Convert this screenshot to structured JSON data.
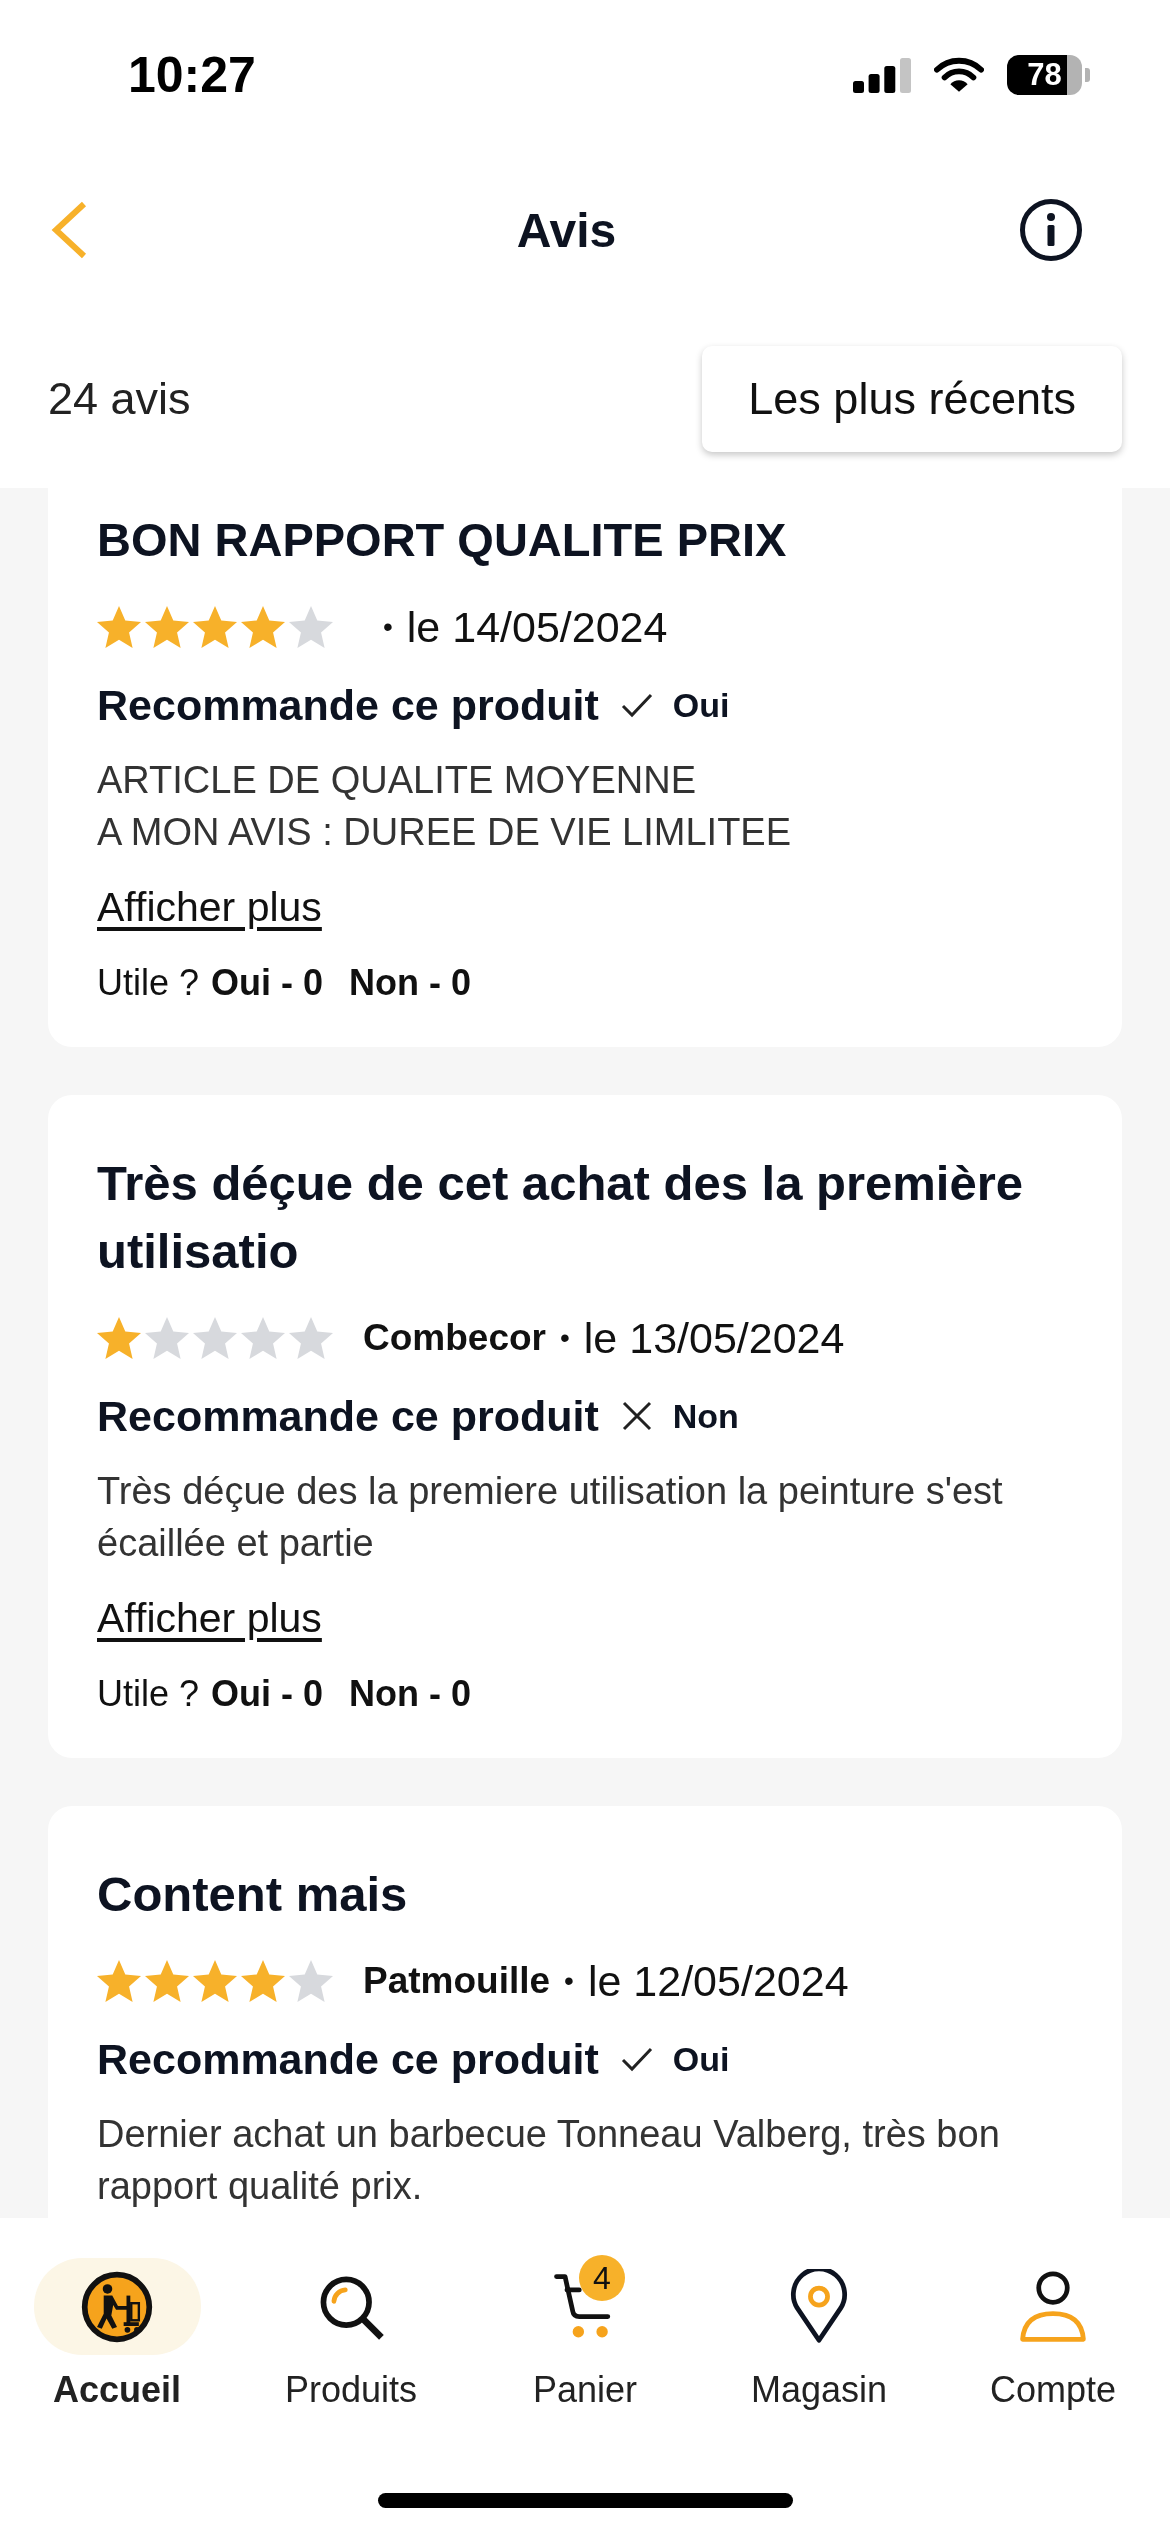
{
  "status_bar": {
    "time": "10:27",
    "battery": "78"
  },
  "header": {
    "title": "Avis"
  },
  "toolbar": {
    "count": "24 avis",
    "sort": "Les plus récents"
  },
  "reviews": [
    {
      "title": "BON RAPPORT QUALITE PRIX",
      "stars": 4,
      "separator": "•",
      "date": "le 14/05/2024",
      "recommend_label": "Recommande ce produit",
      "recommended": true,
      "recommend_answer": "Oui",
      "body": "ARTICLE DE QUALITE MOYENNE\nA MON AVIS : DUREE DE VIE LIMLITEE",
      "more_link": "Afficher plus",
      "helpful": {
        "label": "Utile ?",
        "yes": "Oui - 0",
        "no": "Non - 0"
      }
    },
    {
      "title": "Très déçue de cet achat des la première utilisatio",
      "stars": 1,
      "author": "Combecor",
      "separator": "•",
      "date": "le 13/05/2024",
      "recommend_label": "Recommande ce produit",
      "recommended": false,
      "recommend_answer": "Non",
      "body": "Très déçue des la premiere utilisation la peinture s'est écaillée et partie",
      "more_link": "Afficher plus",
      "helpful": {
        "label": "Utile ?",
        "yes": "Oui - 0",
        "no": "Non - 0"
      }
    },
    {
      "title": "Content mais",
      "stars": 4,
      "author": "Patmouille",
      "separator": "•",
      "date": "le 12/05/2024",
      "recommend_label": "Recommande ce produit",
      "recommended": true,
      "recommend_answer": "Oui",
      "body": "Dernier achat un barbecue Tonneau Valberg, très bon rapport qualité prix."
    }
  ],
  "nav": [
    {
      "label": "Accueil",
      "selected": true
    },
    {
      "label": "Produits",
      "selected": false
    },
    {
      "label": "Panier",
      "selected": false,
      "badge": "4"
    },
    {
      "label": "Magasin",
      "selected": false
    },
    {
      "label": "Compte",
      "selected": false
    }
  ]
}
